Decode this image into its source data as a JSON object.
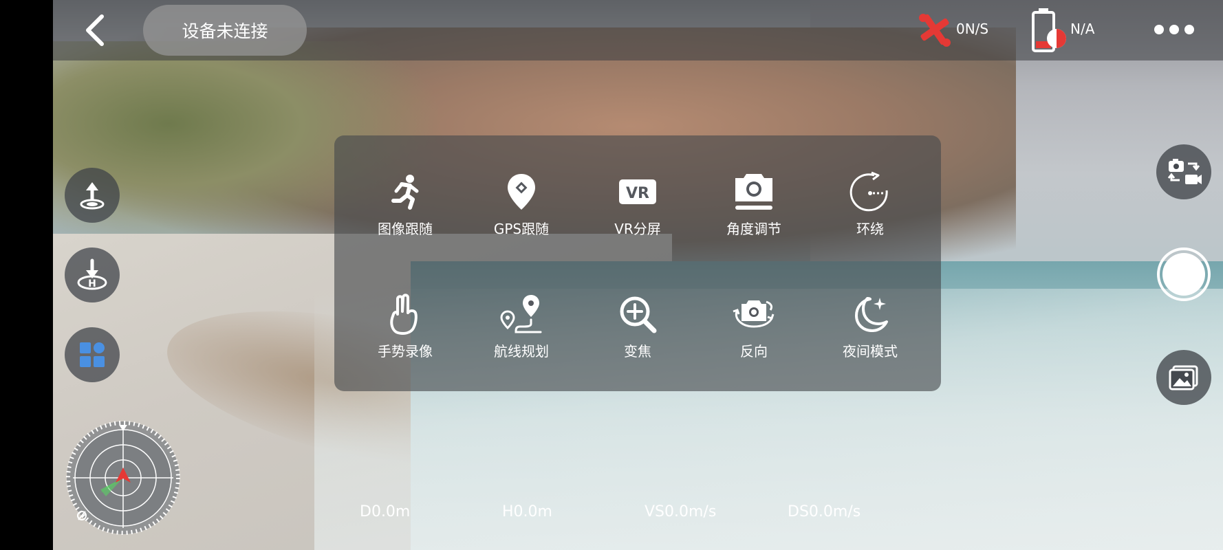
{
  "header": {
    "connection_status": "设备未连接",
    "signal_text": "0N/S",
    "battery_text": "N/A"
  },
  "menu": {
    "items": [
      {
        "label": "图像跟随",
        "icon": "running-person-icon"
      },
      {
        "label": "GPS跟随",
        "icon": "location-pin-icon"
      },
      {
        "label": "VR分屏",
        "icon": "vr-icon"
      },
      {
        "label": "角度调节",
        "icon": "camera-angle-icon"
      },
      {
        "label": "环绕",
        "icon": "orbit-icon"
      },
      {
        "label": "手势录像",
        "icon": "gesture-hand-icon"
      },
      {
        "label": "航线规划",
        "icon": "route-plan-icon"
      },
      {
        "label": "变焦",
        "icon": "zoom-in-icon"
      },
      {
        "label": "反向",
        "icon": "reverse-camera-icon"
      },
      {
        "label": "夜间模式",
        "icon": "night-mode-icon"
      }
    ]
  },
  "telemetry": {
    "distance": "D0.0m",
    "height": "H0.0m",
    "vertical_speed": "VS0.0m/s",
    "horizontal_speed": "DS0.0m/s"
  },
  "colors": {
    "signal_red": "#e53935",
    "battery_red": "#e53935",
    "apps_blue": "#4a90e2"
  }
}
